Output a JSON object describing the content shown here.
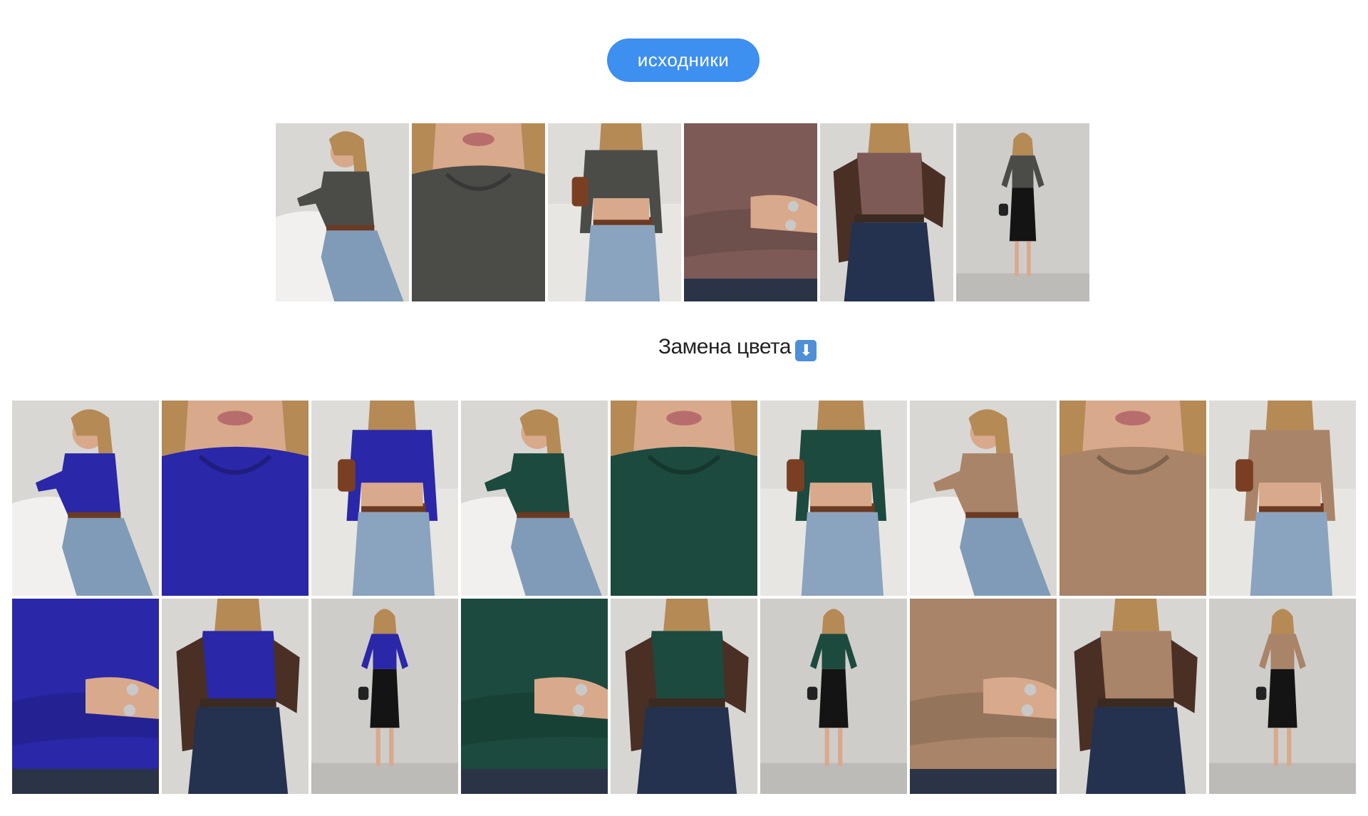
{
  "source_button": {
    "label": "исходники"
  },
  "source_photos": [
    {
      "name": "source-seated",
      "shot": "seated",
      "shirt": "#4b4c48",
      "bottom": "#7f9bb7",
      "bg": "#d9d7d3"
    },
    {
      "name": "source-neckline",
      "shot": "closeup",
      "shirt": "#4b4c48",
      "bottom": "#4b4c48",
      "bg": "#c9c5bf"
    },
    {
      "name": "source-standing-jeans",
      "shot": "standing",
      "shirt": "#4b4c48",
      "bottom": "#8aa4bf",
      "bg": "#dedcd8"
    },
    {
      "name": "source-torso-detail",
      "shot": "torso",
      "shirt": "#7d5a56",
      "bottom": "#2b3346",
      "bg": "#7d5a56"
    },
    {
      "name": "source-jacket",
      "shot": "jacket",
      "shirt": "#7d5a56",
      "bottom": "#24314f",
      "bg": "#d8d6d2"
    },
    {
      "name": "source-full-skirt",
      "shot": "full",
      "shirt": "#4b4c48",
      "bottom": "#141414",
      "bg": "#cfcdca"
    }
  ],
  "caption": {
    "text": "Замена цвета",
    "icon": "down-arrow-emoji"
  },
  "recolor_photos": [
    {
      "name": "blue-seated",
      "shot": "seated",
      "shirt": "#2a27a8",
      "bottom": "#7f9bb7",
      "bg": "#d9d7d3"
    },
    {
      "name": "blue-neckline",
      "shot": "closeup",
      "shirt": "#2a27a8",
      "bottom": "#2a27a8",
      "bg": "#c9c5bf"
    },
    {
      "name": "blue-standing-jeans",
      "shot": "standing",
      "shirt": "#2a27a8",
      "bottom": "#8aa4bf",
      "bg": "#dedcd8"
    },
    {
      "name": "green-seated",
      "shot": "seated",
      "shirt": "#1c4a3e",
      "bottom": "#7f9bb7",
      "bg": "#d9d7d3"
    },
    {
      "name": "green-neckline",
      "shot": "closeup",
      "shirt": "#1c4a3e",
      "bottom": "#1c4a3e",
      "bg": "#c9c5bf"
    },
    {
      "name": "green-standing-jeans",
      "shot": "standing",
      "shirt": "#1c4a3e",
      "bottom": "#8aa4bf",
      "bg": "#dedcd8"
    },
    {
      "name": "tan-seated",
      "shot": "seated",
      "shirt": "#a98468",
      "bottom": "#7f9bb7",
      "bg": "#d9d7d3"
    },
    {
      "name": "tan-neckline",
      "shot": "closeup",
      "shirt": "#a98468",
      "bottom": "#a98468",
      "bg": "#c9c5bf"
    },
    {
      "name": "tan-standing-jeans",
      "shot": "standing",
      "shirt": "#a98468",
      "bottom": "#8aa4bf",
      "bg": "#dedcd8"
    },
    {
      "name": "blue-torso-detail",
      "shot": "torso",
      "shirt": "#2a27a8",
      "bottom": "#2b3346",
      "bg": "#2a27a8"
    },
    {
      "name": "blue-jacket",
      "shot": "jacket",
      "shirt": "#2a27a8",
      "bottom": "#24314f",
      "bg": "#d8d6d2"
    },
    {
      "name": "blue-full-skirt",
      "shot": "full",
      "shirt": "#2a27a8",
      "bottom": "#141414",
      "bg": "#cfcdca"
    },
    {
      "name": "green-torso-detail",
      "shot": "torso",
      "shirt": "#1c4a3e",
      "bottom": "#2b3346",
      "bg": "#1c4a3e"
    },
    {
      "name": "green-jacket",
      "shot": "jacket",
      "shirt": "#1c4a3e",
      "bottom": "#24314f",
      "bg": "#d8d6d2"
    },
    {
      "name": "green-full-skirt",
      "shot": "full",
      "shirt": "#1c4a3e",
      "bottom": "#141414",
      "bg": "#cfcdca"
    },
    {
      "name": "tan-torso-detail",
      "shot": "torso",
      "shirt": "#a98468",
      "bottom": "#2b3346",
      "bg": "#a98468"
    },
    {
      "name": "tan-jacket",
      "shot": "jacket",
      "shirt": "#a98468",
      "bottom": "#24314f",
      "bg": "#d8d6d2"
    },
    {
      "name": "tan-full-skirt",
      "shot": "full",
      "shirt": "#a98468",
      "bottom": "#141414",
      "bg": "#cfcdca"
    }
  ]
}
